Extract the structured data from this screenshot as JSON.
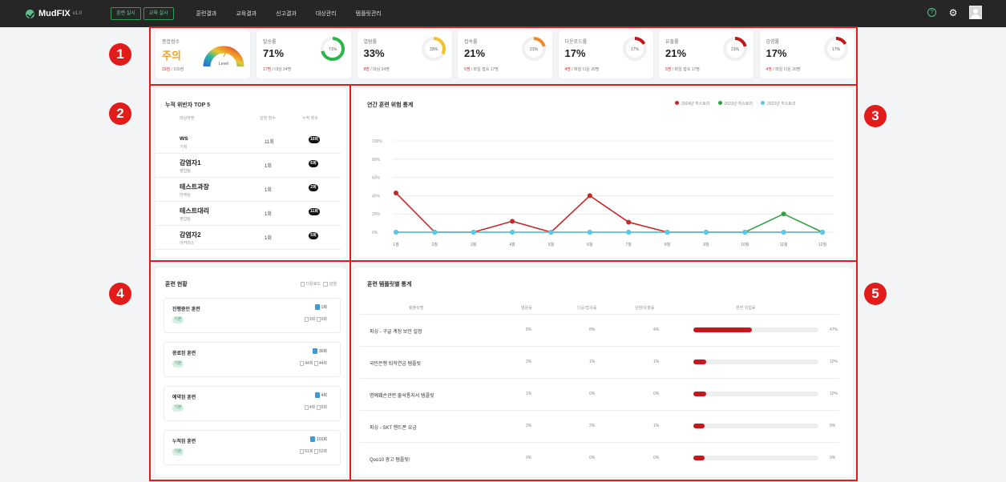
{
  "topbar": {
    "app_name": "MudFIX",
    "version": "v1.0",
    "btn_training": "훈련 실시",
    "btn_education": "교육 실시",
    "nav": [
      "훈련결과",
      "교육결과",
      "신고결과",
      "대상관리",
      "템플릿관리"
    ],
    "help_icon_label": "?"
  },
  "markers": [
    "1",
    "2",
    "3",
    "4",
    "5"
  ],
  "stats": {
    "overall": {
      "label": "종합점수",
      "value": "주의",
      "sub_red": "33점",
      "sub": " / 100점",
      "gauge_label": "Level",
      "color": "#f0a030"
    },
    "cards": [
      {
        "label": "발송률",
        "value": "71%",
        "sub_red": "17명",
        "sub": " / 대상 24명",
        "ring": "71%",
        "pct": 71,
        "color": "#2cb34a"
      },
      {
        "label": "열람률",
        "value": "33%",
        "sub_red": "8명",
        "sub": " / 대상 24명",
        "ring": "33%",
        "pct": 33,
        "color": "#f2c12e"
      },
      {
        "label": "접속률",
        "value": "21%",
        "sub_red": "5명",
        "sub": " / 파일 접속 17명",
        "ring": "21%",
        "pct": 21,
        "color": "#f08a2e"
      },
      {
        "label": "다운로드률",
        "value": "17%",
        "sub_red": "4명",
        "sub": " / 파일 다운 20명",
        "ring": "17%",
        "pct": 17,
        "color": "#c01818"
      },
      {
        "label": "유출률",
        "value": "21%",
        "sub_red": "5명",
        "sub": " / 파일 접속 17명",
        "ring": "21%",
        "pct": 21,
        "color": "#c01818"
      },
      {
        "label": "감염률",
        "value": "17%",
        "sub_red": "4명",
        "sub": " / 파일 다운 20명",
        "ring": "17%",
        "pct": 17,
        "color": "#c01818"
      }
    ]
  },
  "top5": {
    "title": "누적 위반자 TOP 5",
    "headers": [
      "대상자명",
      "감염 횟수",
      "누적 횟수"
    ],
    "rows": [
      {
        "name": "ws",
        "dept": "기획",
        "count": "11회",
        "badge": "10회"
      },
      {
        "name": "감염자1",
        "dept": "영업팀",
        "count": "1회",
        "badge": "6회"
      },
      {
        "name": "테스트과장",
        "dept": "마케팅",
        "count": "1회",
        "badge": "2회"
      },
      {
        "name": "테스트대리",
        "dept": "영업팀",
        "count": "1회",
        "badge": "11회"
      },
      {
        "name": "감염자2",
        "dept": "이커머스",
        "count": "1회",
        "badge": "5회"
      }
    ]
  },
  "annual": {
    "title": "연간 훈련 위험 통계",
    "legend": [
      {
        "name": "2024년 히스토리",
        "color": "#c62828"
      },
      {
        "name": "2023년 히스토리",
        "color": "#2ea043"
      },
      {
        "name": "2022년 히스토리",
        "color": "#5bc8e8"
      }
    ]
  },
  "chart_data": {
    "type": "line",
    "categories": [
      "1월",
      "2월",
      "3월",
      "4월",
      "5월",
      "6월",
      "7월",
      "8월",
      "9월",
      "10월",
      "11월",
      "12월"
    ],
    "yticks": [
      "100%",
      "80%",
      "60%",
      "40%",
      "20%",
      "0%"
    ],
    "ylim": [
      0,
      100
    ],
    "series": [
      {
        "name": "2024년 히스토리",
        "color": "#c62828",
        "values": [
          43,
          0,
          0,
          12,
          0,
          40,
          11,
          0,
          0,
          0,
          0,
          0
        ]
      },
      {
        "name": "2023년 히스토리",
        "color": "#2ea043",
        "values": [
          0,
          0,
          0,
          0,
          0,
          0,
          0,
          0,
          0,
          0,
          20,
          0
        ]
      },
      {
        "name": "2022년 히스토리",
        "color": "#5bc8e8",
        "values": [
          0,
          0,
          0,
          0,
          0,
          0,
          0,
          0,
          0,
          0,
          0,
          0
        ]
      }
    ]
  },
  "training_status": {
    "title": "훈련 현황",
    "legend_download": "다운로드",
    "legend_infect": "감염",
    "items": [
      {
        "name": "진행중인 훈련",
        "tag": "기본",
        "count": "1회",
        "sub1": "3회",
        "sub2": "0회"
      },
      {
        "name": "종료된 훈련",
        "tag": "기본",
        "count": "30회",
        "sub1": "44회",
        "sub2": "44회"
      },
      {
        "name": "예약된 훈련",
        "tag": "기본",
        "count": "4회",
        "sub1": "4회",
        "sub2": "5회"
      },
      {
        "name": "누적된 훈련",
        "tag": "기본",
        "count": "101회",
        "sub1": "51회",
        "sub2": "52회"
      }
    ]
  },
  "templates": {
    "title": "훈련 템플릿별 통계",
    "headers": [
      "템플릿명",
      "열람률",
      "다운/접속률",
      "감염/유출률",
      "훈련 위험률"
    ],
    "rows": [
      {
        "name": "피싱 - 구글 계정 보안 설정",
        "open": "8%",
        "down": "8%",
        "infect": "4%",
        "risk": 47,
        "risk_label": "47%"
      },
      {
        "name": "국민은행 퇴직연금 템플릿",
        "open": "2%",
        "down": "1%",
        "infect": "1%",
        "risk": 10,
        "risk_label": "10%"
      },
      {
        "name": "명예훼손관련 출석통지서 템플릿",
        "open": "1%",
        "down": "0%",
        "infect": "0%",
        "risk": 10,
        "risk_label": "10%"
      },
      {
        "name": "피싱 - SKT 핸드폰 요금",
        "open": "2%",
        "down": "2%",
        "infect": "1%",
        "risk": 9,
        "risk_label": "9%"
      },
      {
        "name": "Qoo10 광고 템플릿!",
        "open": "0%",
        "down": "0%",
        "infect": "0%",
        "risk": 0,
        "risk_label": "0%"
      }
    ]
  }
}
